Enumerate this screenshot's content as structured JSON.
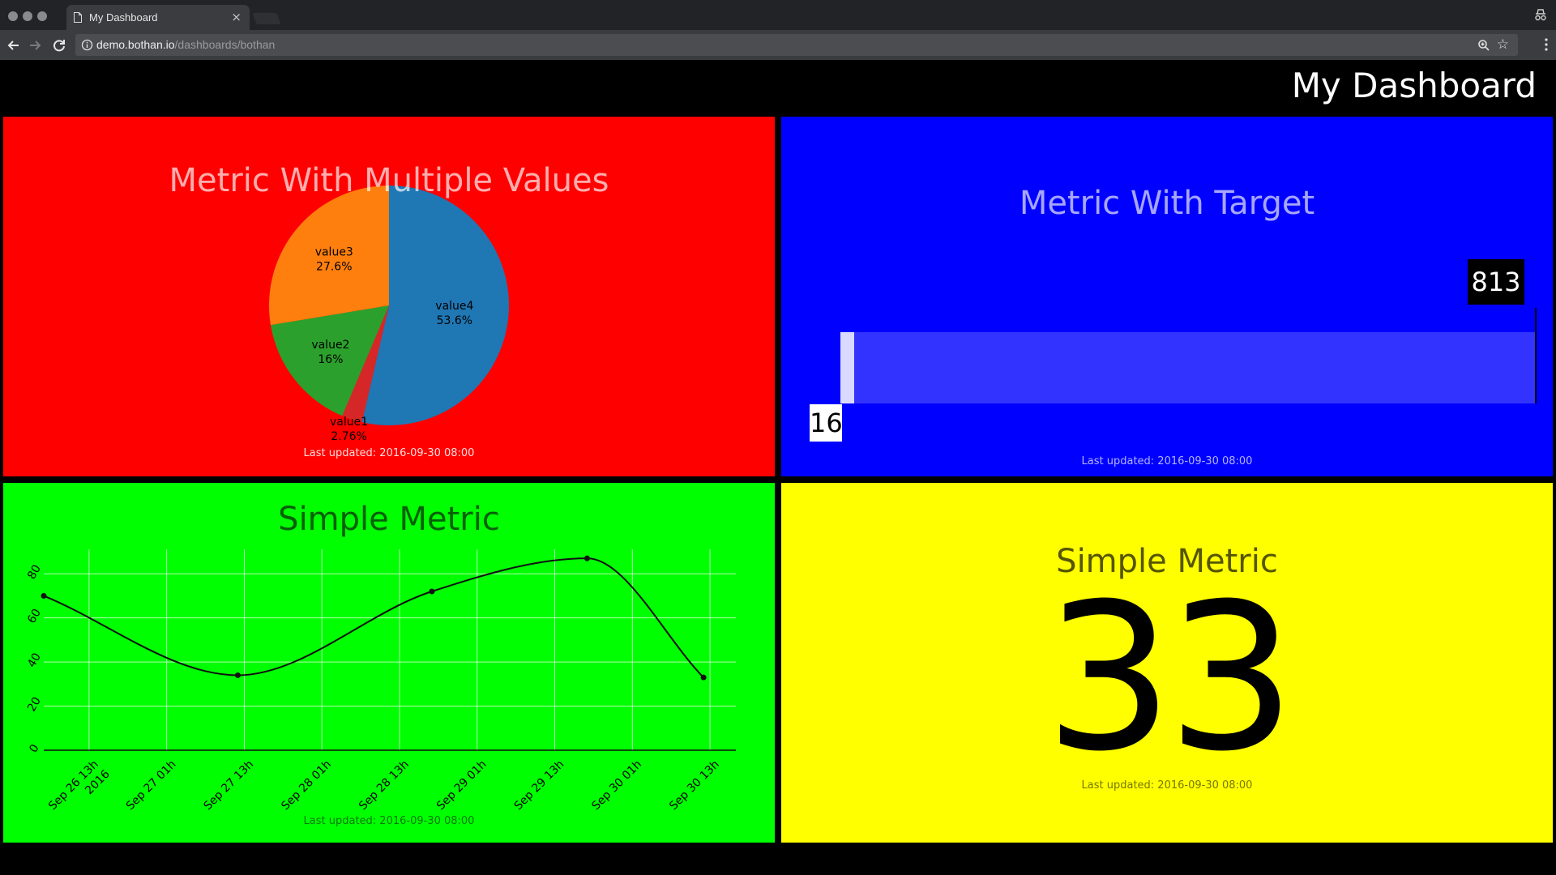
{
  "browser": {
    "tab_title": "My Dashboard",
    "tab_close": "×",
    "url_host": "demo.bothan.io",
    "url_path": "/dashboards/bothan",
    "star": "☆"
  },
  "dashboard": {
    "title": "My Dashboard"
  },
  "panels": {
    "pie": {
      "title": "Metric With Multiple Values",
      "updated": "Last updated: 2016-09-30 08:00",
      "background": "#ff0000",
      "labels": [
        {
          "name": "value4",
          "pct": "53.6%"
        },
        {
          "name": "value1",
          "pct": "2.76%"
        },
        {
          "name": "value2",
          "pct": "16%"
        },
        {
          "name": "value3",
          "pct": "27.6%"
        }
      ]
    },
    "target": {
      "title": "Metric With Target",
      "updated": "Last updated: 2016-09-30 08:00",
      "value": "16",
      "target": "813",
      "value_fraction": 0.02,
      "background": "#0000ff"
    },
    "line": {
      "title": "Simple Metric",
      "updated": "Last updated: 2016-09-30 08:00",
      "background": "#00ff00",
      "y_ticks": [
        "0",
        "20",
        "40",
        "60",
        "80"
      ],
      "x_ticks": [
        [
          "Sep 26 13h",
          "2016"
        ],
        [
          "Sep 27 01h"
        ],
        [
          "Sep 27 13h"
        ],
        [
          "Sep 28 01h"
        ],
        [
          "Sep 28 13h"
        ],
        [
          "Sep 29 01h"
        ],
        [
          "Sep 29 13h"
        ],
        [
          "Sep 30 01h"
        ],
        [
          "Sep 30 13h"
        ]
      ]
    },
    "number": {
      "title": "Simple Metric",
      "value": "33",
      "updated": "Last updated: 2016-09-30 08:00",
      "background": "#ffff00"
    }
  },
  "chart_data": [
    {
      "type": "pie",
      "title": "Metric With Multiple Values",
      "categories": [
        "value4",
        "value1",
        "value2",
        "value3"
      ],
      "values": [
        53.6,
        2.76,
        16.0,
        27.6
      ],
      "colors": [
        "#1f77b4",
        "#d62728",
        "#2ca02c",
        "#ff7f0e"
      ]
    },
    {
      "type": "line",
      "title": "Simple Metric",
      "x": [
        "2016-09-26 06:00",
        "2016-09-27 12:00",
        "2016-09-28 18:00",
        "2016-09-29 18:00",
        "2016-09-30 12:00"
      ],
      "values": [
        70,
        34,
        72,
        87,
        33
      ],
      "ylim": [
        0,
        90
      ],
      "xlim": [
        "2016-09-26 06:00",
        "2016-09-30 17:00"
      ],
      "grid": true
    }
  ]
}
